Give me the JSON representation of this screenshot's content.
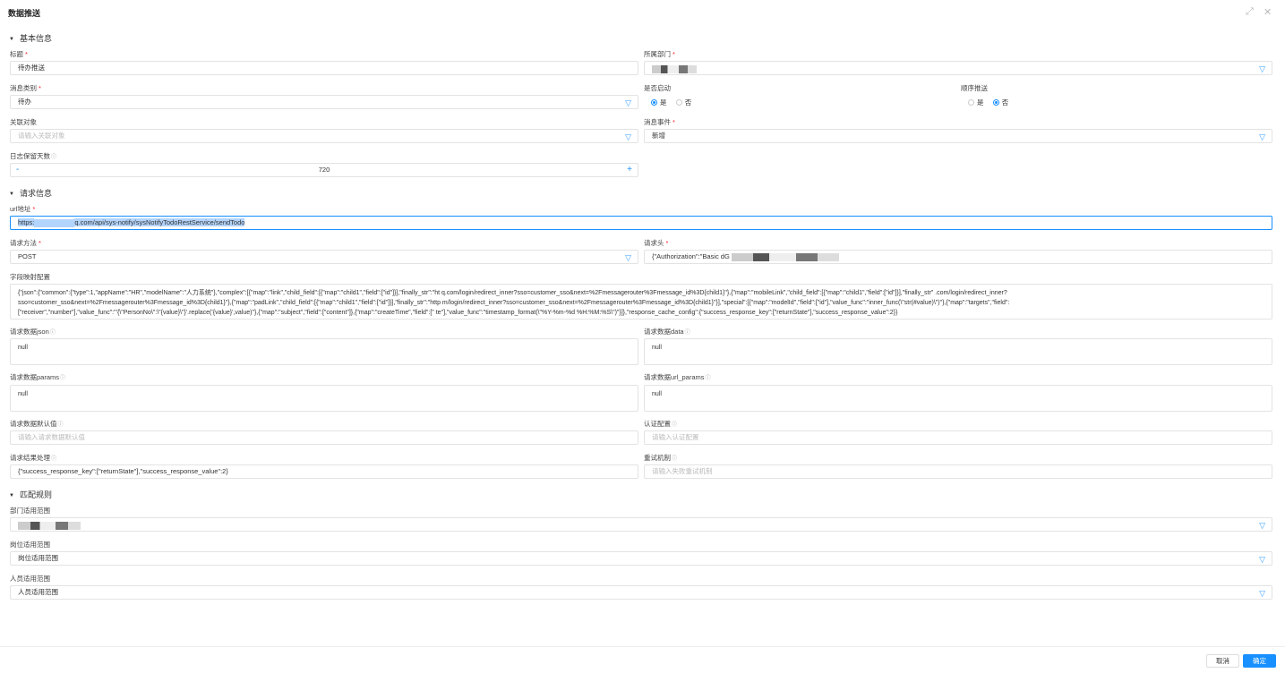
{
  "header": {
    "title": "数据推送",
    "edit_icon": "expand-icon",
    "close_icon": "close-icon"
  },
  "sections": {
    "basic": "基本信息",
    "request": "请求信息",
    "match": "匹配规则"
  },
  "basic": {
    "title_label": "标题",
    "title_value": "待办推送",
    "dept_label": "所属部门",
    "msg_type_label": "消息类别",
    "msg_type_value": "待办",
    "enabled_label": "是否启动",
    "enabled_yes": "是",
    "enabled_no": "否",
    "enabled_value": "是",
    "order_label": "顺序推送",
    "order_yes": "是",
    "order_no": "否",
    "order_value": "否",
    "related_label": "关联对象",
    "related_placeholder": "请输入关联对象",
    "event_label": "消息事件",
    "event_value": "新增",
    "log_days_label": "日志保留天数",
    "log_days_value": "720",
    "minus": "-",
    "plus": "+"
  },
  "request": {
    "url_label": "url地址",
    "url_prefix": "https:",
    "url_suffix": "q.com/api/sys-notify/sysNotifyTodoRestService/sendTodo",
    "method_label": "请求方法",
    "method_value": "POST",
    "headers_label": "请求头",
    "headers_value": "{\"Authorization\":\"Basic dG",
    "mapping_label": "字段映射配置",
    "mapping_lines": [
      "{\"json\":{\"common\":{\"type\":1,\"appName\":\"HR\",\"modelName\":\"人力系统\"},\"complex\":[{\"map\":\"link\",\"child_field\":[{\"map\":\"child1\",\"field\":[\"id\"]}],\"finally_str\":\"ht                    q.com/login/redirect_inner?sso=customer_sso&next=%2Fmessagerouter%3Fmessage_id%3D{child1}\"},{\"map\":\"mobileLink\",\"child_field\":[{\"map\":\"child1\",\"field\":[\"id\"]}],\"finally_str\"                    .com/login/redirect_inner?",
      "sso=customer_sso&next=%2Fmessagerouter%3Fmessage_id%3D{child1}\"},{\"map\":\"padLink\",\"child_field\":[{\"map\":\"child1\",\"field\":[\"id\"]}],\"finally_str\":\"http                    m/login/redirect_inner?sso=customer_sso&next=%2Fmessagerouter%3Fmessage_id%3D{child1}\"}],\"special\":[{\"map\":\"modelId\",\"field\":[\"id\"],\"value_func\":\"inner_func(\\\"str(#value)\\\")\"},{\"map\":\"targets\",\"field\":",
      "[\"receiver\",\"number\"],\"value_func\":\"'{\\\"PersonNo\\\":\\\"{value}\\\"}'.replace('{value}',value)\"},{\"map\":\"subject\",\"field\":[\"content\"]},{\"map\":\"createTime\",\"field\":[\"            te\"],\"value_func\":\"timestamp_format(\\\"%Y-%m-%d %H:%M:%S\\\")\"}]},\"response_cache_config\":{\"success_response_key\":[\"returnState\"],\"success_response_value\":2}}"
    ],
    "json_label": "请求数据json",
    "json_value": "null",
    "data_label": "请求数据data",
    "data_value": "null",
    "params_label": "请求数据params",
    "params_value": "null",
    "url_params_label": "请求数据url_params",
    "url_params_value": "null",
    "default_label": "请求数据默认值",
    "default_placeholder": "请输入请求数据默认值",
    "auth_label": "认证配置",
    "auth_placeholder": "请输入认证配置",
    "result_label": "请求结果处理",
    "result_value": "{\"success_response_key\":[\"returnState\"],\"success_response_value\":2}",
    "retry_label": "重试机制",
    "retry_placeholder": "请输入失败重试机制"
  },
  "match": {
    "dept_label": "部门适用范围",
    "post_label": "岗位适用范围",
    "post_placeholder": "岗位适用范围",
    "person_label": "人员适用范围",
    "person_placeholder": "人员适用范围"
  },
  "footer": {
    "cancel": "取消",
    "confirm": "确定"
  },
  "colors": {
    "primary": "#1890ff",
    "required": "#f5222d",
    "icon": "#3ca0ff"
  }
}
